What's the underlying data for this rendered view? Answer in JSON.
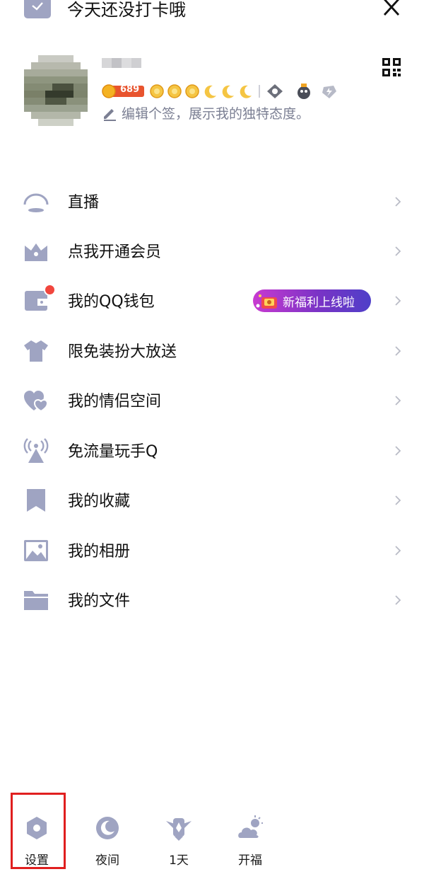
{
  "topbar": {
    "checkin_text": "今天还没打卡哦"
  },
  "profile": {
    "level_number": "689",
    "signature": "编辑个签，展示我的独特态度。"
  },
  "menu": {
    "items": [
      {
        "label": "直播",
        "icon": "live-icon"
      },
      {
        "label": "点我开通会员",
        "icon": "crown-icon"
      },
      {
        "label": "我的QQ钱包",
        "icon": "wallet-icon"
      },
      {
        "label": "限免装扮大放送",
        "icon": "shirt-icon"
      },
      {
        "label": "我的情侣空间",
        "icon": "hearts-icon"
      },
      {
        "label": "免流量玩手Q",
        "icon": "antenna-icon"
      },
      {
        "label": "我的收藏",
        "icon": "bookmark-icon"
      },
      {
        "label": "我的相册",
        "icon": "photo-icon"
      },
      {
        "label": "我的文件",
        "icon": "folder-icon"
      }
    ],
    "wallet_promo": "新福利上线啦"
  },
  "bottom": {
    "items": [
      {
        "label": "设置",
        "icon": "settings-icon"
      },
      {
        "label": "夜间",
        "icon": "moon-icon"
      },
      {
        "label": "1天",
        "icon": "badge-icon"
      },
      {
        "label": "开福",
        "icon": "weather-icon"
      }
    ]
  },
  "colors": {
    "icon_gray": "#9fa4c2",
    "promo_start": "#c83ad0",
    "promo_end": "#4f3fc8",
    "red_dot": "#f1463d",
    "highlight": "#e01f1f"
  }
}
